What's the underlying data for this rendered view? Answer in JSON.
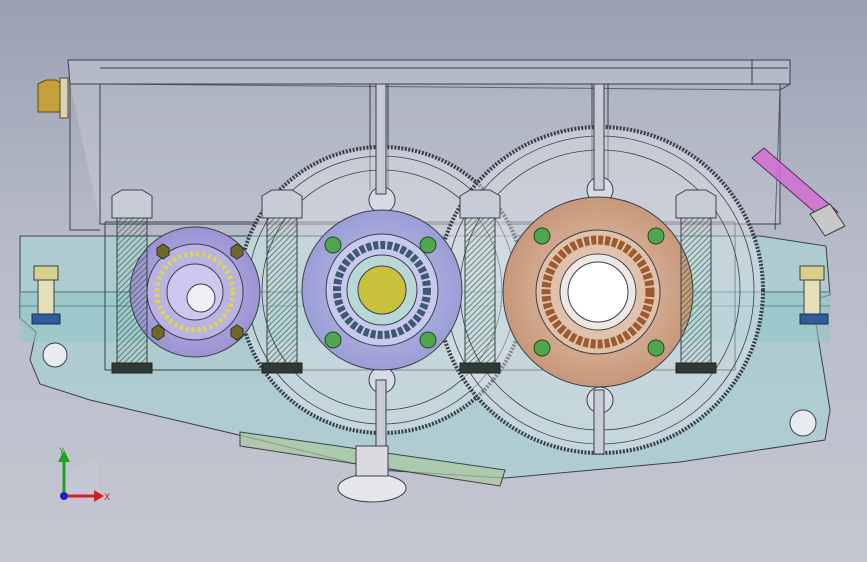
{
  "triad": {
    "y_label": "Y",
    "x_label": "X"
  },
  "colors": {
    "background_top": "#9aa1b3",
    "background_bottom": "#c4c7d1",
    "housing_line": "#3a4048",
    "oil_fill": "#8fc6c8",
    "bearing_cap_left": "#a9a3d8",
    "bearing_cap_mid": "#a6a8dc",
    "bearing_cap_right": "#d7b29a",
    "bolt_green": "#4fa64f",
    "shaft_yellow": "#c9c23c",
    "dipstick_magenta": "#d46fd4",
    "axis_x": "#d62020",
    "axis_y": "#22a022",
    "axis_z": "#2020c8"
  },
  "icons": [
    "coordinate-triad-icon"
  ]
}
